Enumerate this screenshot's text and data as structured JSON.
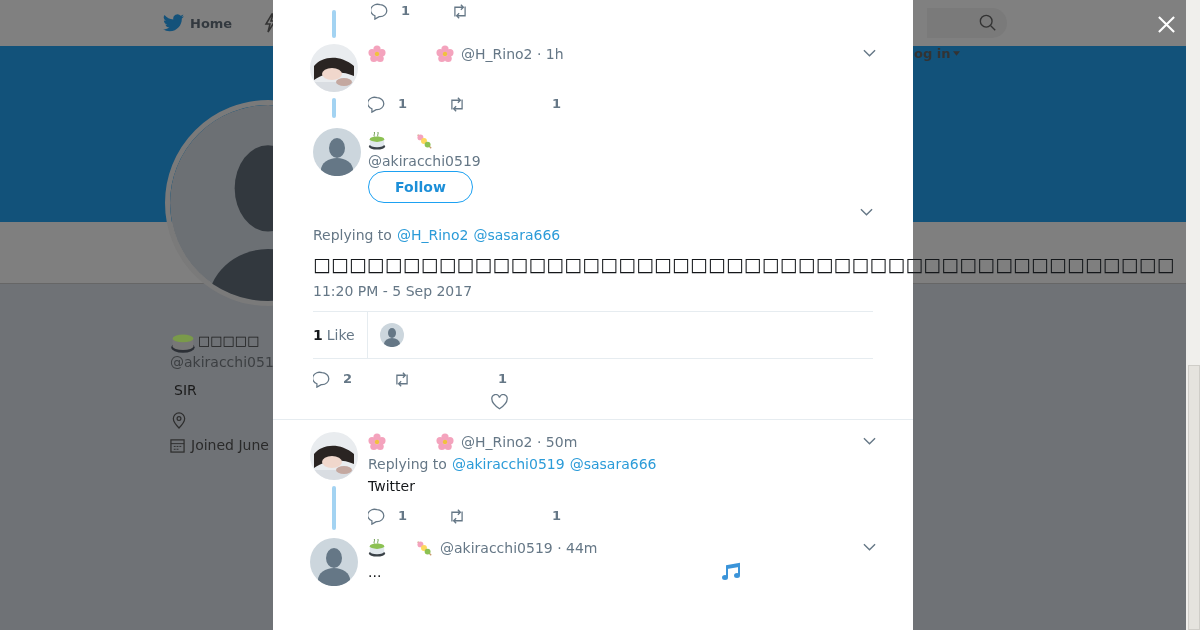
{
  "nav": {
    "home": "Home",
    "login": "og in"
  },
  "profile": {
    "name": "□□□□□",
    "handle": "@akiracchi051",
    "bio": "SIR",
    "joined": "Joined June"
  },
  "thread_above": {
    "reply_count": "1"
  },
  "tweets": [
    {
      "kind": "ancestor",
      "meta": "@H_Rino2 · 1h",
      "reply_count": "1",
      "like_count": "1"
    },
    {
      "kind": "focused",
      "avatar": {
        "kind": "default"
      },
      "handle": "@akiracchi0519",
      "follow": "Follow",
      "replying_label": "Replying to",
      "mentions": [
        "@H_Rino2",
        "@sasara666"
      ],
      "text": "□□□□□□□□□□□□□□□□□□□□□□□□□□□□□□□□□□□□□□□□□□□□□□□□",
      "timestamp": "11:20 PM - 5 Sep 2017",
      "likes": {
        "count": "1",
        "label": "Like"
      },
      "reply_count": "2",
      "like_count": "1"
    },
    {
      "kind": "reply",
      "meta": "@H_Rino2 · 50m",
      "replying_label": "Replying to",
      "mentions": [
        "@akiracchi0519",
        "@sasara666"
      ],
      "text": "Twitter",
      "reply_count": "1",
      "like_count": "1"
    },
    {
      "kind": "last",
      "avatar": {
        "kind": "default"
      },
      "meta": "@akiracchi0519 · 44m",
      "text": "..."
    }
  ]
}
